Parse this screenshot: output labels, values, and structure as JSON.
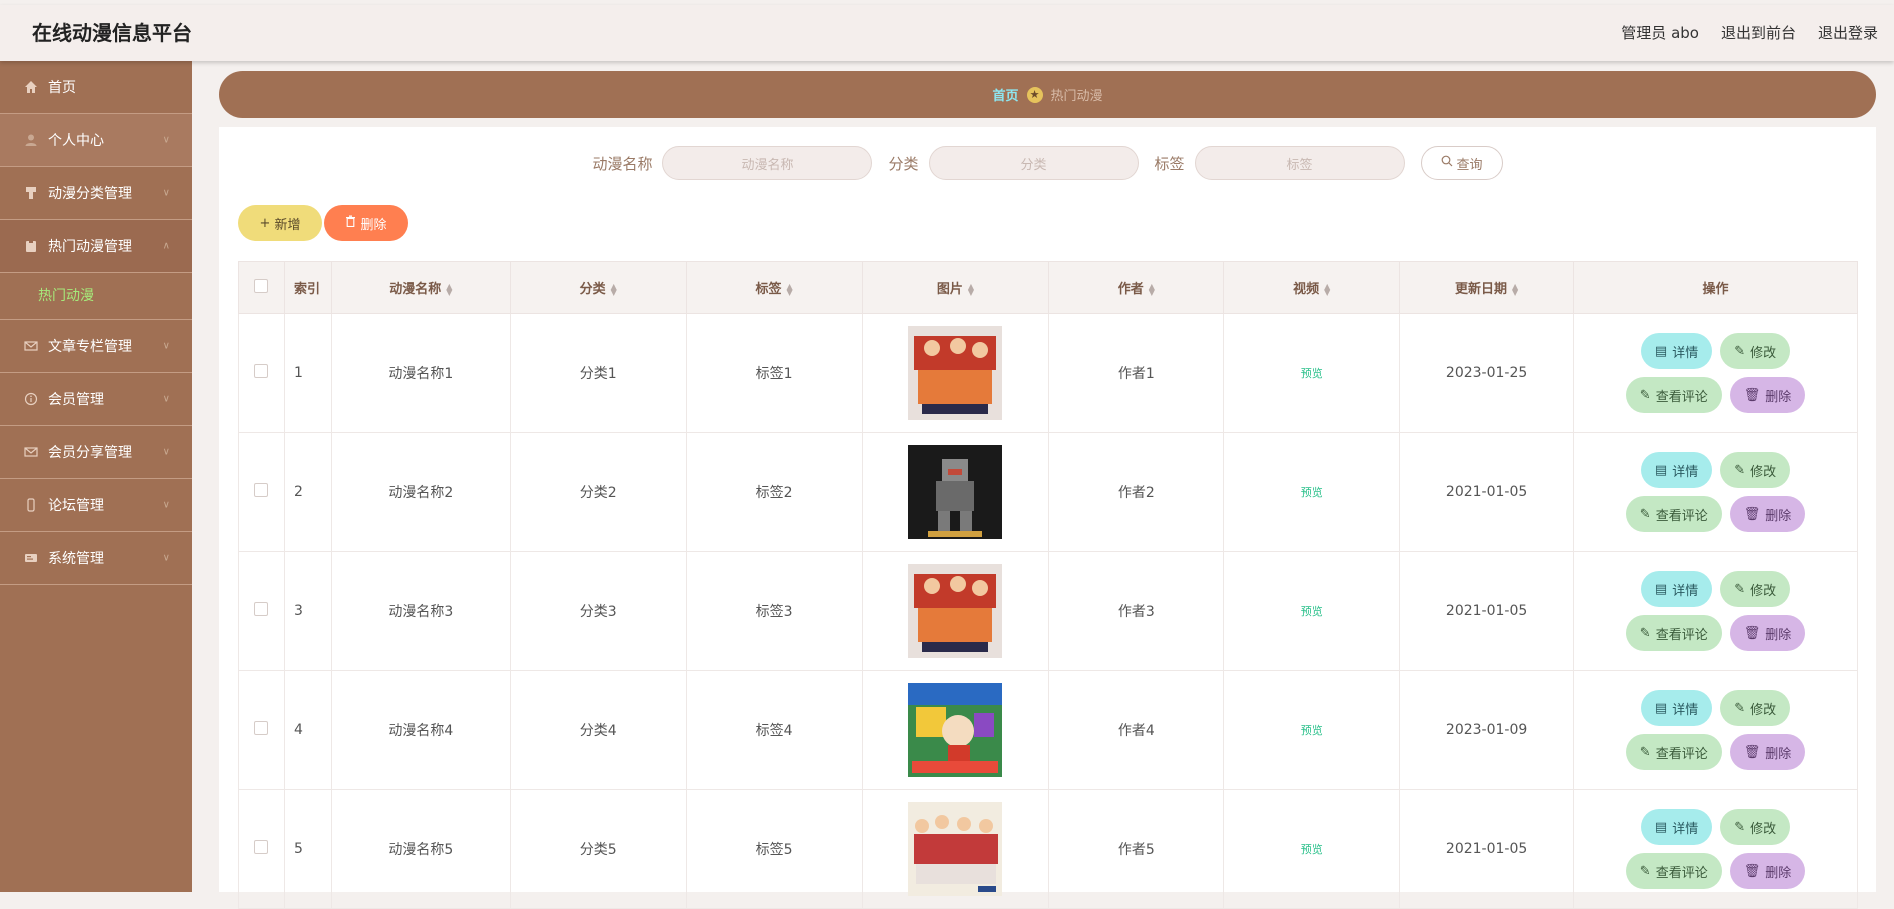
{
  "header": {
    "title": "在线动漫信息平台",
    "user": "管理员 abo",
    "front": "退出到前台",
    "logout": "退出登录"
  },
  "sidebar": {
    "items": [
      {
        "label": "首页",
        "icon": "home-icon"
      },
      {
        "label": "个人中心",
        "icon": "person-icon"
      },
      {
        "label": "动漫分类管理",
        "icon": "category-icon"
      },
      {
        "label": "热门动漫管理",
        "icon": "clipboard-icon"
      },
      {
        "label": "文章专栏管理",
        "icon": "mail-icon"
      },
      {
        "label": "会员管理",
        "icon": "info-circle-icon"
      },
      {
        "label": "会员分享管理",
        "icon": "mail-icon"
      },
      {
        "label": "论坛管理",
        "icon": "phone-icon"
      },
      {
        "label": "系统管理",
        "icon": "card-icon"
      }
    ],
    "sub_item": "热门动漫"
  },
  "breadcrumb": {
    "home": "首页",
    "current": "热门动漫"
  },
  "search": {
    "name_label": "动漫名称",
    "name_placeholder": "动漫名称",
    "category_label": "分类",
    "category_placeholder": "分类",
    "tag_label": "标签",
    "tag_placeholder": "标签",
    "query": "查询"
  },
  "actions": {
    "add": "新增",
    "delete": "删除"
  },
  "table": {
    "columns": [
      "索引",
      "动漫名称",
      "分类",
      "标签",
      "图片",
      "作者",
      "视频",
      "更新日期",
      "操作"
    ],
    "rows": [
      {
        "index": "1",
        "name": "动漫名称1",
        "category": "分类1",
        "tag": "标签1",
        "author": "作者1",
        "video": "预览",
        "date": "2023-01-25"
      },
      {
        "index": "2",
        "name": "动漫名称2",
        "category": "分类2",
        "tag": "标签2",
        "author": "作者2",
        "video": "预览",
        "date": "2021-01-05"
      },
      {
        "index": "3",
        "name": "动漫名称3",
        "category": "分类3",
        "tag": "标签3",
        "author": "作者3",
        "video": "预览",
        "date": "2021-01-05"
      },
      {
        "index": "4",
        "name": "动漫名称4",
        "category": "分类4",
        "tag": "标签4",
        "author": "作者4",
        "video": "预览",
        "date": "2023-01-09"
      },
      {
        "index": "5",
        "name": "动漫名称5",
        "category": "分类5",
        "tag": "标签5",
        "author": "作者5",
        "video": "预览",
        "date": "2021-01-05"
      }
    ],
    "row_actions": {
      "detail": "详情",
      "edit": "修改",
      "comment": "查看评论",
      "remove": "删除"
    }
  },
  "colors": {
    "brand": "#a07054",
    "accent_green": "#a6e87a",
    "link_cyan": "#8ee6f0",
    "preview_green": "#29c08a"
  }
}
